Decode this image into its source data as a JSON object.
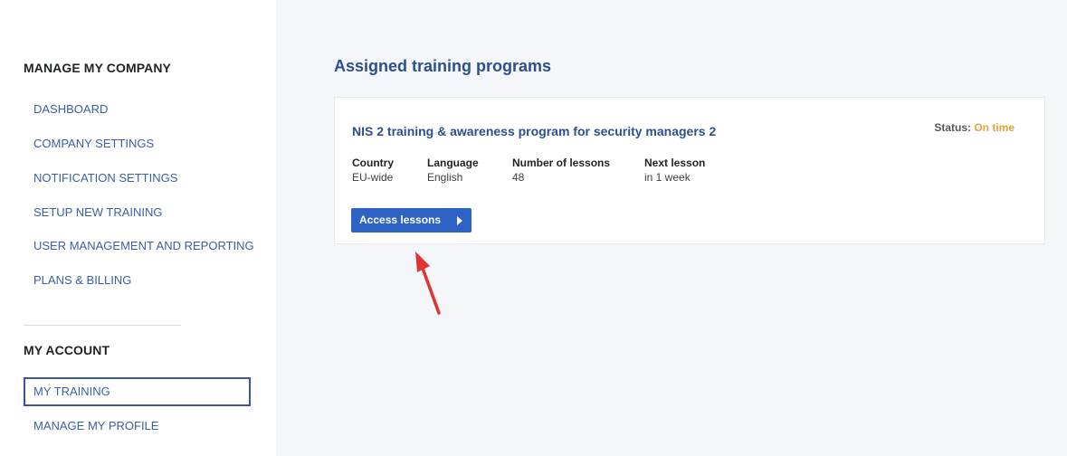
{
  "sidebar": {
    "company_heading": "MANAGE MY COMPANY",
    "company_items": [
      {
        "label": "DASHBOARD"
      },
      {
        "label": "COMPANY SETTINGS"
      },
      {
        "label": "NOTIFICATION SETTINGS"
      },
      {
        "label": "SETUP NEW TRAINING"
      },
      {
        "label": "USER MANAGEMENT AND REPORTING"
      },
      {
        "label": "PLANS & BILLING"
      }
    ],
    "account_heading": "MY ACCOUNT",
    "account_items": [
      {
        "label": "MY TRAINING",
        "active": true
      },
      {
        "label": "MANAGE MY PROFILE",
        "active": false
      }
    ]
  },
  "main": {
    "page_title": "Assigned training programs",
    "program": {
      "title": "NIS 2 training & awareness program for security managers 2",
      "status_label": "Status:",
      "status_value": "On time",
      "country_label": "Country",
      "country_value": "EU-wide",
      "language_label": "Language",
      "language_value": "English",
      "lessons_label": "Number of lessons",
      "lessons_value": "48",
      "next_label": "Next lesson",
      "next_value": "in 1 week",
      "access_button_label": "Access lessons"
    }
  },
  "colors": {
    "accent": "#2f62c5",
    "nav_text": "#3a5fa7",
    "status_on_time": "#e8a13a",
    "annotation_arrow": "#e03434"
  },
  "icons": {
    "access_button_icon": "caret-right-icon",
    "annotation": "red-arrow-icon"
  }
}
